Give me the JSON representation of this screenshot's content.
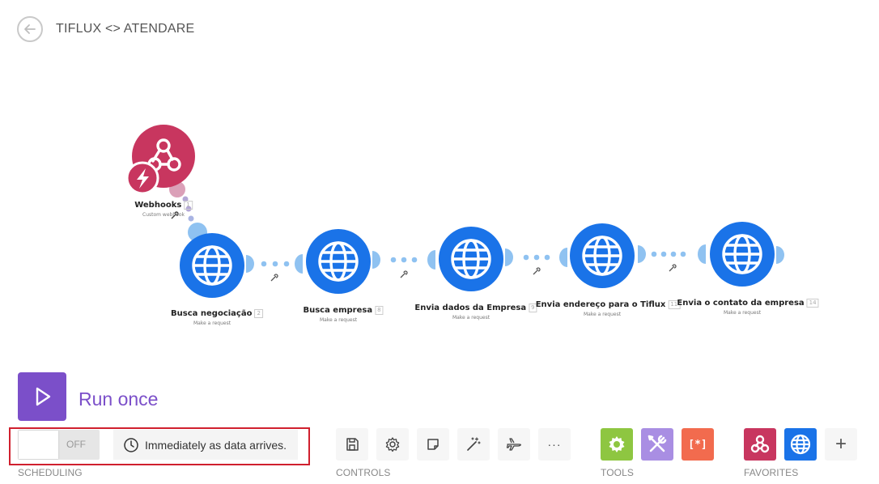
{
  "header": {
    "title": "TIFLUX <> ATENDARE"
  },
  "modules": [
    {
      "name": "Webhooks",
      "number": "1",
      "subtitle": "Custom webhook",
      "app": "webhooks"
    },
    {
      "name": "Busca negociação",
      "number": "2",
      "subtitle": "Make a request",
      "app": "http"
    },
    {
      "name": "Busca empresa",
      "number": "8",
      "subtitle": "Make a request",
      "app": "http"
    },
    {
      "name": "Envia dados da Empresa",
      "number": "9",
      "subtitle": "Make a request",
      "app": "http"
    },
    {
      "name": "Envia endereço para o Tiflux",
      "number": "11",
      "subtitle": "Make a request",
      "app": "http"
    },
    {
      "name": "Envia o contato da empresa",
      "number": "14",
      "subtitle": "Make a request",
      "app": "http"
    }
  ],
  "run": {
    "label": "Run once"
  },
  "scheduling": {
    "toggle_state": "OFF",
    "schedule_text": "Immediately as data arrives.",
    "section_label": "SCHEDULING"
  },
  "controls": {
    "section_label": "CONTROLS",
    "more_glyph": "···"
  },
  "tools": {
    "section_label": "TOOLS",
    "items": [
      {
        "name": "flow-control",
        "color": "#8ec641"
      },
      {
        "name": "tools",
        "color": "#a98ee3"
      },
      {
        "name": "text-parser",
        "color": "#f26b4e",
        "glyph": "[*]"
      }
    ]
  },
  "favorites": {
    "section_label": "FAVORITES",
    "items": [
      {
        "name": "webhooks",
        "color": "#c8365f"
      },
      {
        "name": "http",
        "color": "#1a73e8"
      }
    ],
    "add_glyph": "+"
  },
  "colors": {
    "http_blue": "#1a73e8",
    "webhook_red": "#c8365f",
    "run_purple": "#7b4fc9",
    "connector_blue": "#8fc2f1",
    "highlight_red": "#d0202e"
  }
}
